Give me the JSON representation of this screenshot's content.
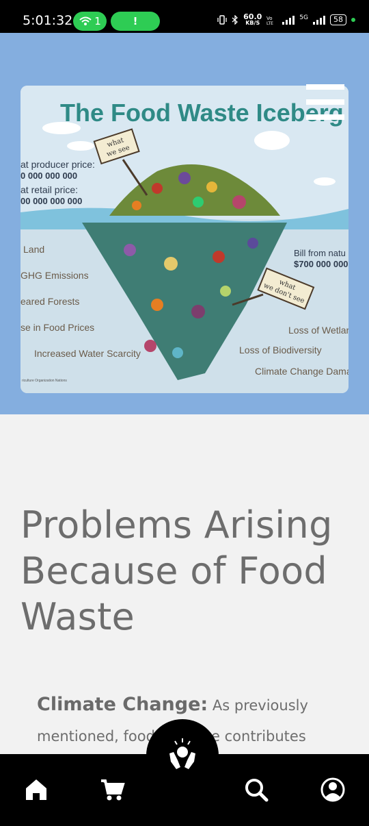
{
  "status_bar": {
    "time": "5:01:32",
    "hotspot_count": "1",
    "alert_glyph": "!",
    "speed_value": "60.0",
    "speed_unit": "KB/S",
    "network": "5G",
    "battery": "58"
  },
  "hero": {
    "image_title": "The Food Waste Iceberg",
    "sign_top": "what we see",
    "sign_bottom": "what we don't see",
    "left_labels": [
      "at producer price:",
      "0 000 000 000",
      "at retail price:",
      "00 000 000 000",
      "Land",
      "GHG Emissions",
      "eared Forests",
      "se in Food Prices",
      "Increased Water Scarcity"
    ],
    "right_labels": [
      "Bill from natu",
      "$700 000 000",
      "Loss of Wetlar",
      "Loss of Biodiversity",
      "Climate Change Dama"
    ],
    "footnote": "riculture Organization Nations"
  },
  "content": {
    "heading": "Problems Arising Because of Food Waste",
    "para_bold": "Climate Change:",
    "para_text": " As previously mentioned, food wastage contributes"
  },
  "nav": {
    "items": [
      "home",
      "cart",
      "donate",
      "search",
      "account"
    ]
  }
}
